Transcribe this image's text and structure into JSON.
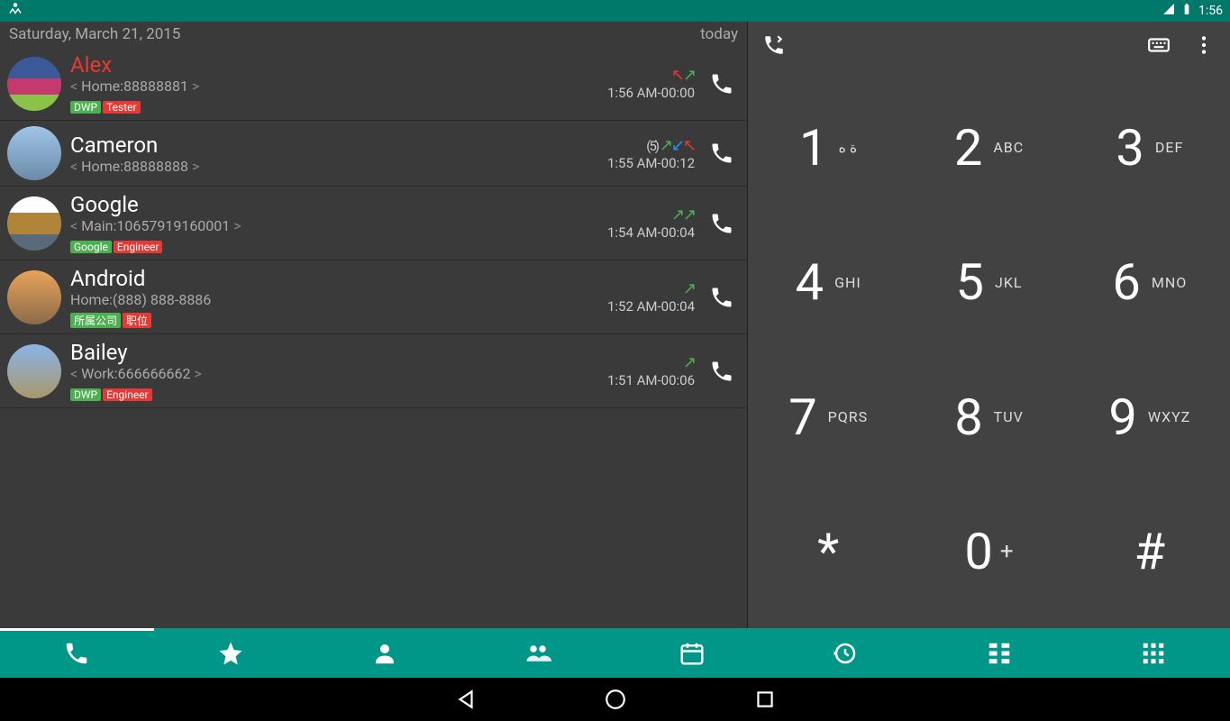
{
  "statusbar": {
    "time": "1:56"
  },
  "header": {
    "date": "Saturday, March 21, 2015",
    "today": "today"
  },
  "entries": [
    {
      "name": "Alex",
      "missed": true,
      "sub_prefix": "< ",
      "sub": "Home:88888881",
      "sub_suffix": " >",
      "tags": [
        {
          "t": "DWP",
          "c": "tagG"
        },
        {
          "t": "Tester",
          "c": "tagR"
        }
      ],
      "count": "",
      "arrows": [
        {
          "c": "ain",
          "g": "↖"
        },
        {
          "c": "aout",
          "g": "↗"
        }
      ],
      "time": "1:56 AM-00:00"
    },
    {
      "name": "Cameron",
      "missed": false,
      "sub_prefix": "< ",
      "sub": "Home:88888888",
      "sub_suffix": " >",
      "tags": [],
      "count": "(5)",
      "arrows": [
        {
          "c": "aout",
          "g": "↗"
        },
        {
          "c": "amiss",
          "g": "↙"
        },
        {
          "c": "ain",
          "g": "↖"
        }
      ],
      "time": "1:55 AM-00:12"
    },
    {
      "name": "Google",
      "missed": false,
      "sub_prefix": "< ",
      "sub": "Main:10657919160001",
      "sub_suffix": " >",
      "tags": [
        {
          "t": "Google",
          "c": "tagG"
        },
        {
          "t": "Engineer",
          "c": "tagR"
        }
      ],
      "count": "",
      "arrows": [
        {
          "c": "aout",
          "g": "↗"
        },
        {
          "c": "aout",
          "g": "↗"
        }
      ],
      "time": "1:54 AM-00:04"
    },
    {
      "name": "Android",
      "missed": false,
      "sub_prefix": "",
      "sub": "Home:(888) 888-8886",
      "sub_suffix": "",
      "tags": [
        {
          "t": "所属公司",
          "c": "tagG"
        },
        {
          "t": "职位",
          "c": "tagR"
        }
      ],
      "count": "",
      "arrows": [
        {
          "c": "aout",
          "g": "↗"
        }
      ],
      "time": "1:52 AM-00:04"
    },
    {
      "name": "Bailey",
      "missed": false,
      "sub_prefix": "< ",
      "sub": "Work:666666662",
      "sub_suffix": " >",
      "tags": [
        {
          "t": "DWP",
          "c": "tagG"
        },
        {
          "t": "Engineer",
          "c": "tagR"
        }
      ],
      "count": "",
      "arrows": [
        {
          "c": "aout",
          "g": "↗"
        }
      ],
      "time": "1:51 AM-00:06"
    }
  ],
  "keypad": [
    {
      "num": "1",
      "letters": "ة ه"
    },
    {
      "num": "2",
      "letters": "ABC"
    },
    {
      "num": "3",
      "letters": "DEF"
    },
    {
      "num": "4",
      "letters": "GHI"
    },
    {
      "num": "5",
      "letters": "JKL"
    },
    {
      "num": "6",
      "letters": "MNO"
    },
    {
      "num": "7",
      "letters": "PQRS"
    },
    {
      "num": "8",
      "letters": "TUV"
    },
    {
      "num": "9",
      "letters": "WXYZ"
    },
    {
      "num": "*",
      "letters": ""
    },
    {
      "num": "0",
      "letters": "+"
    },
    {
      "num": "#",
      "letters": ""
    }
  ],
  "tabs": [
    "phone",
    "favorites",
    "contact",
    "groups",
    "calendar",
    "history",
    "grid-large",
    "grid"
  ]
}
